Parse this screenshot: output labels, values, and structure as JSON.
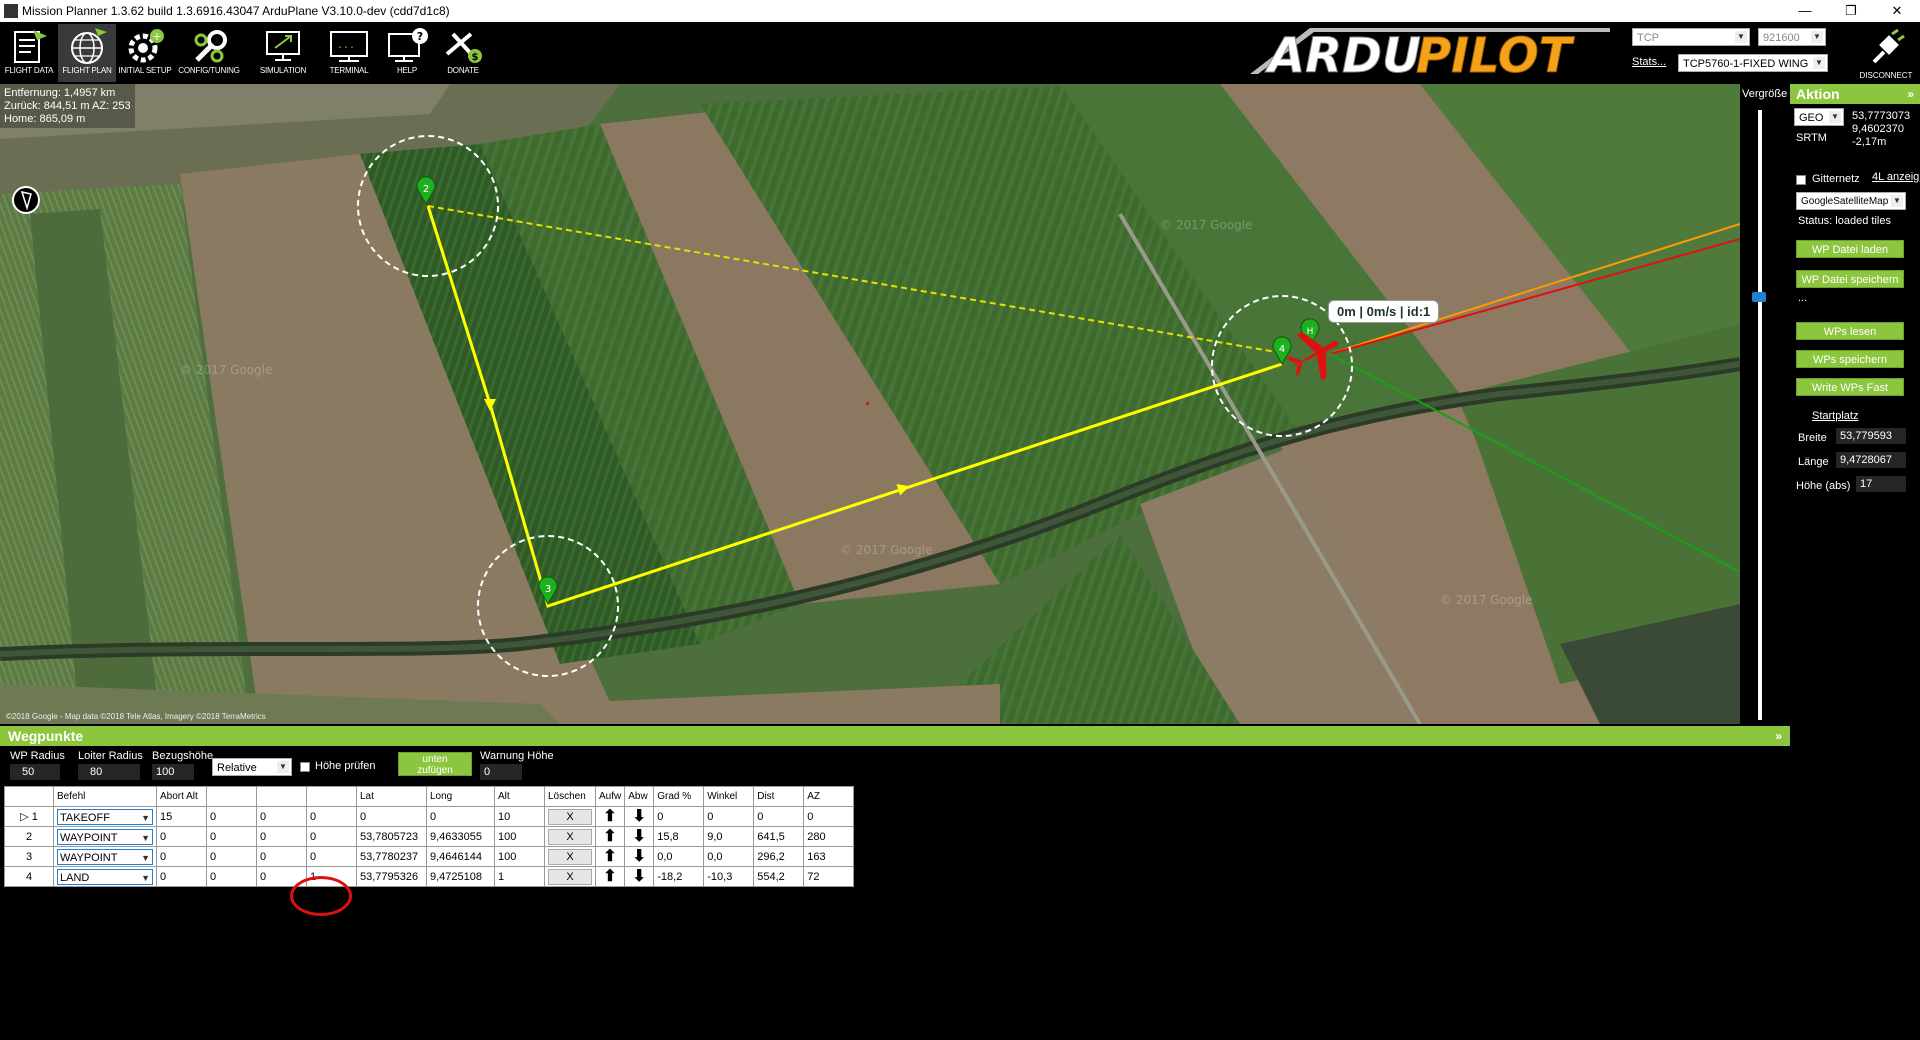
{
  "window": {
    "title": "Mission Planner 1.3.62 build 1.3.6916.43047 ArduPlane V3.10.0-dev (cdd7d1c8)",
    "min": "—",
    "max": "❐",
    "close": "✕"
  },
  "toolbar": {
    "items": [
      {
        "label": "FLIGHT DATA",
        "icon": "flight-data-icon"
      },
      {
        "label": "FLIGHT PLAN",
        "icon": "globe-icon"
      },
      {
        "label": "INITIAL SETUP",
        "icon": "initial-setup-icon"
      },
      {
        "label": "CONFIG/TUNING",
        "icon": "wrench-icon"
      },
      {
        "label": "SIMULATION",
        "icon": "simulation-icon"
      },
      {
        "label": "TERMINAL",
        "icon": "terminal-icon"
      },
      {
        "label": "HELP",
        "icon": "help-icon"
      },
      {
        "label": "DONATE",
        "icon": "donate-icon"
      }
    ],
    "logo": {
      "part1": "ARDU",
      "part2": "PILOT"
    },
    "connection_type": "TCP",
    "baud_rate": "921600",
    "stats_link": "Stats...",
    "vehicle": "TCP5760-1-FIXED WING",
    "disconnect_label": "DISCONNECT"
  },
  "map": {
    "info": {
      "distance": "Entfernung: 1,4957 km",
      "back": "Zurück: 844,51 m AZ: 253",
      "home": "Home: 865,09 m"
    },
    "tooltip": "0m | 0m/s | id:1",
    "attribution": "©2018 Google - Map data ©2018 Tele Atlas, Imagery ©2018 TerraMetrics",
    "watermark": "© 2017 Google",
    "waypoint_labels": [
      "2",
      "3",
      "4",
      "H"
    ],
    "zoom_label": "Vergröße"
  },
  "action_panel": {
    "title": "Aktion",
    "collapse": "»",
    "coord_system": "GEO",
    "lat": "53,7773073",
    "lng": "9,4602370",
    "alt": "-2,17m",
    "srtm": "SRTM",
    "grid_label": "Gitternetz",
    "kml_link": "4L anzeig",
    "map_provider": "GoogleSatelliteMap",
    "status": "Status: loaded tiles",
    "btn_load_wp_file": "WP Datei laden",
    "btn_save_wp_file": "WP Datei speichern",
    "ellipsis": "...",
    "btn_read_wps": "WPs lesen",
    "btn_write_wps": "WPs speichern",
    "btn_write_wps_fast": "Write WPs Fast",
    "home_title": "Startplatz",
    "home_lat_label": "Breite",
    "home_lat": "53,779593",
    "home_lng_label": "Länge",
    "home_lng": "9,4728067",
    "home_alt_label": "Höhe (abs)",
    "home_alt": "17"
  },
  "waypoints_panel": {
    "title": "Wegpunkte",
    "collapse": "»",
    "wp_radius_label": "WP Radius",
    "wp_radius": "50",
    "loiter_radius_label": "Loiter Radius",
    "loiter_radius": "80",
    "ref_alt_label": "Bezugshöhe",
    "ref_alt": "100",
    "alt_mode": "Relative",
    "check_alt_label": "Höhe prüfen",
    "add_below_btn_line1": "unten",
    "add_below_btn_line2": "zufügen",
    "warn_alt_label": "Warnung Höhe",
    "warn_alt": "0"
  },
  "table": {
    "headers": [
      "Befehl",
      "Abort Alt",
      "",
      "",
      "",
      "Lat",
      "Long",
      "Alt",
      "Löschen",
      "Aufw",
      "Abw",
      "Grad %",
      "Winkel",
      "Dist",
      "AZ"
    ],
    "rows": [
      {
        "num": "1",
        "cmd": "TAKEOFF",
        "p1": "15",
        "p2": "0",
        "p3": "0",
        "p4": "0",
        "lat": "0",
        "lng": "0",
        "alt": "10",
        "del": "X",
        "grad": "0",
        "winkel": "0",
        "dist": "0",
        "az": "0"
      },
      {
        "num": "2",
        "cmd": "WAYPOINT",
        "p1": "0",
        "p2": "0",
        "p3": "0",
        "p4": "0",
        "lat": "53,7805723",
        "lng": "9,4633055",
        "alt": "100",
        "del": "X",
        "grad": "15,8",
        "winkel": "9,0",
        "dist": "641,5",
        "az": "280"
      },
      {
        "num": "3",
        "cmd": "WAYPOINT",
        "p1": "0",
        "p2": "0",
        "p3": "0",
        "p4": "0",
        "lat": "53,7780237",
        "lng": "9,4646144",
        "alt": "100",
        "del": "X",
        "grad": "0,0",
        "winkel": "0,0",
        "dist": "296,2",
        "az": "163"
      },
      {
        "num": "4",
        "cmd": "LAND",
        "p1": "0",
        "p2": "0",
        "p3": "0",
        "p4": "1",
        "lat": "53,7795326",
        "lng": "9,4725108",
        "alt": "1",
        "del": "X",
        "grad": "-18,2",
        "winkel": "-10,3",
        "dist": "554,2",
        "az": "72"
      }
    ]
  },
  "colors": {
    "accent_green": "#8cc63f",
    "route_yellow": "#ffff00",
    "highlight_red": "#e01010"
  }
}
